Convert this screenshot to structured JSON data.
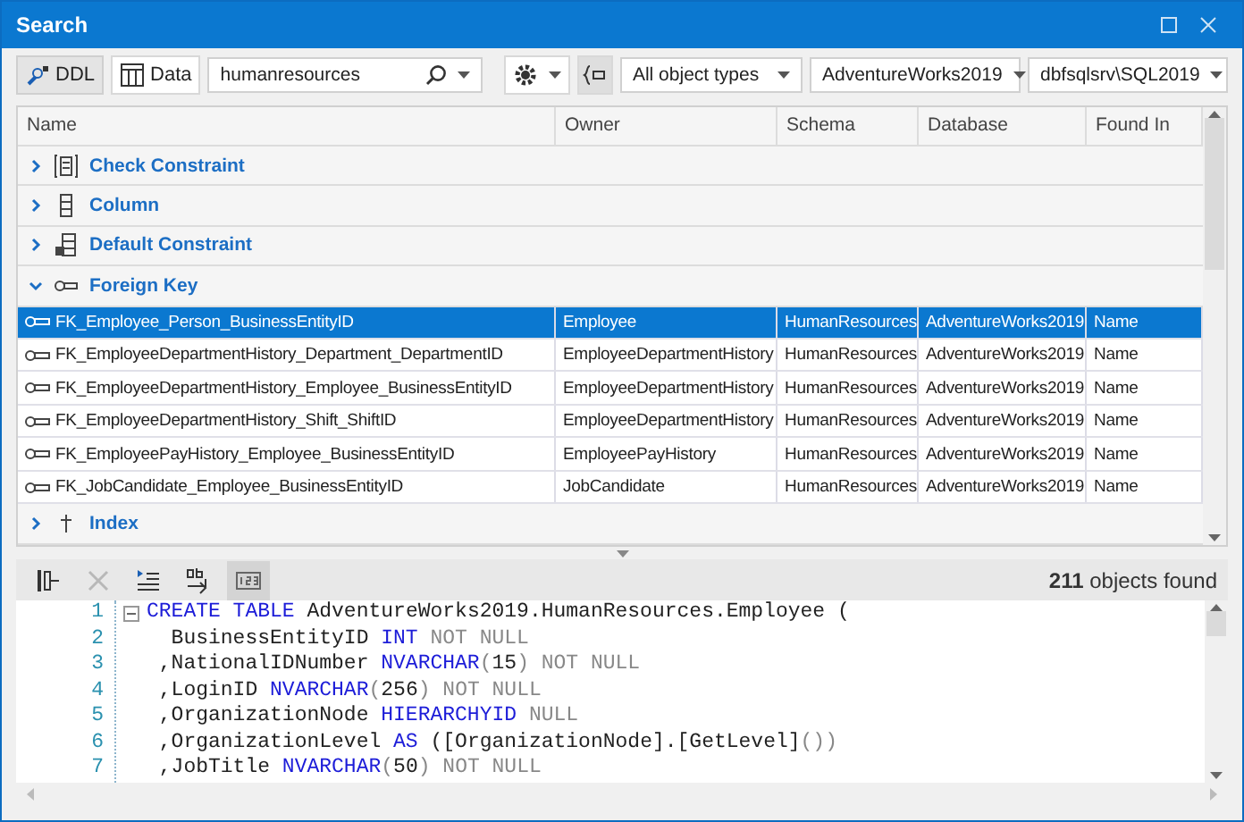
{
  "window": {
    "title": "Search"
  },
  "toolbar": {
    "view_buttons": [
      {
        "label": "DDL",
        "kind": "ddl",
        "selected": true
      },
      {
        "label": "Data",
        "kind": "data",
        "selected": false
      }
    ],
    "search": {
      "value": "humanresources"
    },
    "filter_toggle": {
      "on": true
    },
    "object_types": "All object types",
    "database": "AdventureWorks2019",
    "server": "dbfsqlsrv\\SQL2019"
  },
  "grid": {
    "columns": [
      "Name",
      "Owner",
      "Schema",
      "Database",
      "Found In"
    ],
    "groups": [
      {
        "label": "Check Constraint",
        "kind": "check",
        "expanded": false
      },
      {
        "label": "Column",
        "kind": "column",
        "expanded": false
      },
      {
        "label": "Default Constraint",
        "kind": "default",
        "expanded": false
      },
      {
        "label": "Foreign Key",
        "kind": "key",
        "expanded": true,
        "rows": [
          {
            "cells": [
              "FK_Employee_Person_BusinessEntityID",
              "Employee",
              "HumanResources",
              "AdventureWorks2019",
              "Name"
            ],
            "selected": true
          },
          {
            "cells": [
              "FK_EmployeeDepartmentHistory_Department_DepartmentID",
              "EmployeeDepartmentHistory",
              "HumanResources",
              "AdventureWorks2019",
              "Name"
            ],
            "selected": false
          },
          {
            "cells": [
              "FK_EmployeeDepartmentHistory_Employee_BusinessEntityID",
              "EmployeeDepartmentHistory",
              "HumanResources",
              "AdventureWorks2019",
              "Name"
            ],
            "selected": false
          },
          {
            "cells": [
              "FK_EmployeeDepartmentHistory_Shift_ShiftID",
              "EmployeeDepartmentHistory",
              "HumanResources",
              "AdventureWorks2019",
              "Name"
            ],
            "selected": false
          },
          {
            "cells": [
              "FK_EmployeePayHistory_Employee_BusinessEntityID",
              "EmployeePayHistory",
              "HumanResources",
              "AdventureWorks2019",
              "Name"
            ],
            "selected": false
          },
          {
            "cells": [
              "FK_JobCandidate_Employee_BusinessEntityID",
              "JobCandidate",
              "HumanResources",
              "AdventureWorks2019",
              "Name"
            ],
            "selected": false
          }
        ]
      },
      {
        "label": "Index",
        "kind": "index",
        "expanded": false
      }
    ]
  },
  "code_toolbar": {
    "buttons": [
      {
        "kind": "tree",
        "pressed": false,
        "disabled": false
      },
      {
        "kind": "clear",
        "pressed": false,
        "disabled": true
      },
      {
        "kind": "indent",
        "pressed": false,
        "disabled": false
      },
      {
        "kind": "wrap",
        "pressed": false,
        "disabled": false
      },
      {
        "kind": "numbers",
        "pressed": true,
        "disabled": false
      }
    ],
    "status": "**211** objects found"
  },
  "code": {
    "lines": [
      {
        "number": "1",
        "fold": true,
        "tokens": [
          {
            "text": "CREATE TABLE",
            "kind": "keyword"
          },
          {
            "text": " AdventureWorks2019.HumanResources.Employee (",
            "kind": "plain"
          }
        ]
      },
      {
        "number": "2",
        "fold": false,
        "tokens": [
          {
            "text": "  BusinessEntityID ",
            "kind": "plain"
          },
          {
            "text": "INT",
            "kind": "keyword"
          },
          {
            "text": " NOT NULL",
            "kind": "dim"
          }
        ]
      },
      {
        "number": "3",
        "fold": false,
        "tokens": [
          {
            "text": " ,NationalIDNumber ",
            "kind": "plain"
          },
          {
            "text": "NVARCHAR",
            "kind": "keyword"
          },
          {
            "text": "(",
            "kind": "dim"
          },
          {
            "text": "15",
            "kind": "plain"
          },
          {
            "text": ") NOT NULL",
            "kind": "dim"
          }
        ]
      },
      {
        "number": "4",
        "fold": false,
        "tokens": [
          {
            "text": " ,LoginID ",
            "kind": "plain"
          },
          {
            "text": "NVARCHAR",
            "kind": "keyword"
          },
          {
            "text": "(",
            "kind": "dim"
          },
          {
            "text": "256",
            "kind": "plain"
          },
          {
            "text": ") NOT NULL",
            "kind": "dim"
          }
        ]
      },
      {
        "number": "5",
        "fold": false,
        "tokens": [
          {
            "text": " ,OrganizationNode ",
            "kind": "plain"
          },
          {
            "text": "HIERARCHYID",
            "kind": "keyword"
          },
          {
            "text": " NULL",
            "kind": "dim"
          }
        ]
      },
      {
        "number": "6",
        "fold": false,
        "tokens": [
          {
            "text": " ,OrganizationLevel ",
            "kind": "plain"
          },
          {
            "text": "AS",
            "kind": "keyword"
          },
          {
            "text": " ([OrganizationNode].[GetLevel]",
            "kind": "plain"
          },
          {
            "text": "())",
            "kind": "dim"
          }
        ]
      },
      {
        "number": "7",
        "fold": false,
        "tokens": [
          {
            "text": " ,JobTitle ",
            "kind": "plain"
          },
          {
            "text": "NVARCHAR",
            "kind": "keyword"
          },
          {
            "text": "(",
            "kind": "dim"
          },
          {
            "text": "50",
            "kind": "plain"
          },
          {
            "text": ") NOT NULL",
            "kind": "dim"
          }
        ]
      }
    ]
  }
}
